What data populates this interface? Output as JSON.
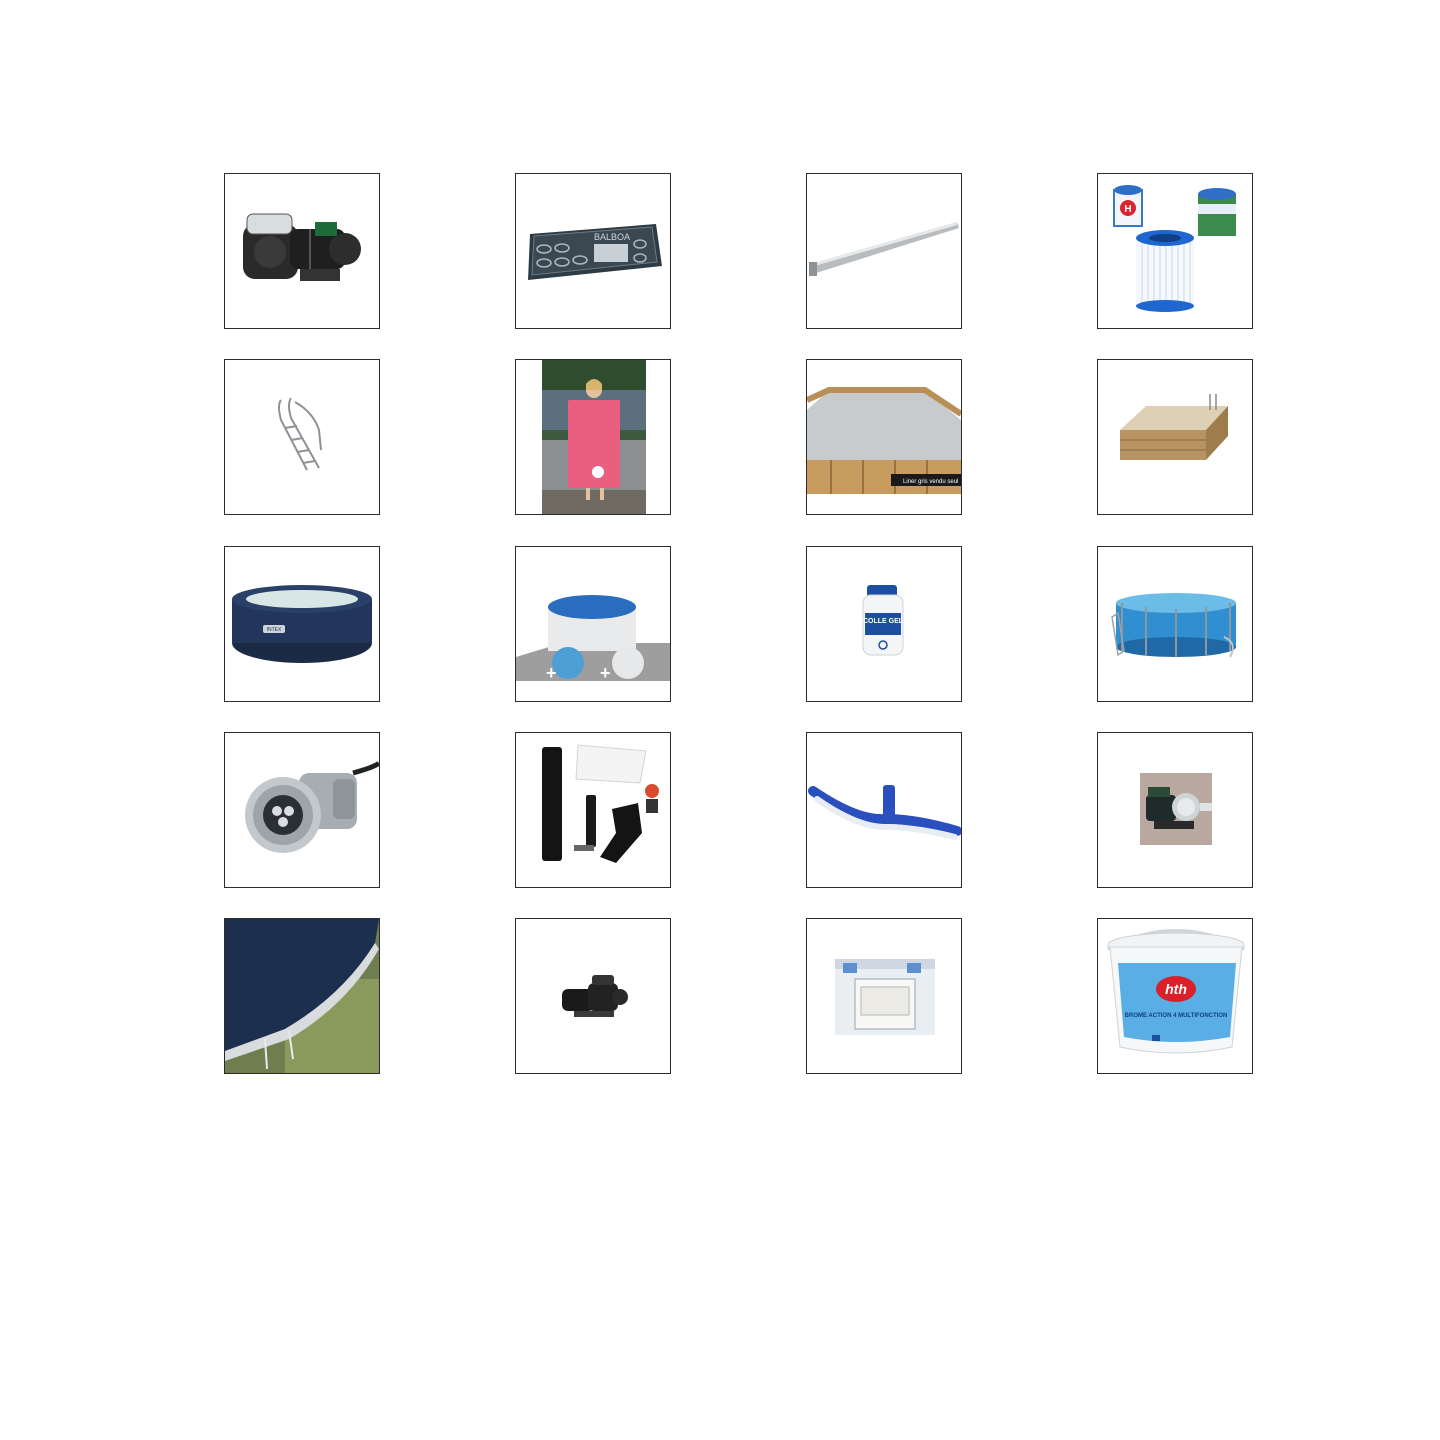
{
  "grid": {
    "columns": 4,
    "rows": 5,
    "border_color": "#2b2b2b",
    "background": "#ffffff"
  },
  "tiles": [
    {
      "name": "pool-pump-icon"
    },
    {
      "name": "spa-control-panel-icon",
      "brand": "BALBOA"
    },
    {
      "name": "aluminium-profile-icon"
    },
    {
      "name": "filter-cartridges-icon",
      "badge": "H"
    },
    {
      "name": "pool-ladder-icon"
    },
    {
      "name": "pink-poncho-towel-icon"
    },
    {
      "name": "wooden-pool-octagonal-icon",
      "caption": "Liner gris vendu seul"
    },
    {
      "name": "wooden-pool-rectangular-icon"
    },
    {
      "name": "inflatable-spa-icon",
      "brand": "INTEX"
    },
    {
      "name": "steel-pool-with-cover-icon"
    },
    {
      "name": "pvc-glue-jar-icon",
      "label": "COLLE GEL"
    },
    {
      "name": "frame-pool-icon"
    },
    {
      "name": "led-spotlight-icon"
    },
    {
      "name": "vacuum-kit-icon"
    },
    {
      "name": "wall-brush-icon"
    },
    {
      "name": "pool-pump-photo-icon"
    },
    {
      "name": "winter-cover-icon"
    },
    {
      "name": "small-pump-icon"
    },
    {
      "name": "skimmer-box-icon"
    },
    {
      "name": "bromine-bucket-icon",
      "brand": "hth",
      "label": "BROME ACTION 4 MULTIFONCTION"
    }
  ]
}
